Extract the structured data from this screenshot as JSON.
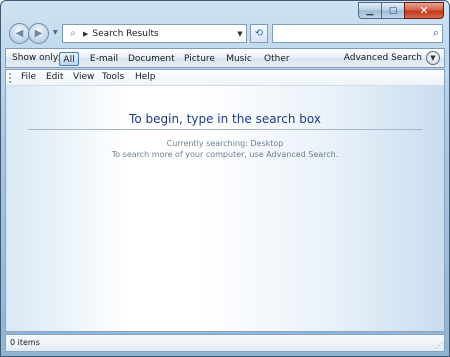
{
  "window": {
    "controls": {
      "minimize": "▁",
      "maximize": "▢",
      "close": "✕"
    }
  },
  "nav": {
    "address_text": "Search Results",
    "search_value": "",
    "icons": {
      "back": "back-arrow-icon",
      "forward": "forward-arrow-icon",
      "address": "search-magnifier-icon",
      "refresh": "refresh-icon",
      "search": "search-icon"
    }
  },
  "filter": {
    "label": "Show only:",
    "items": [
      "All",
      "E-mail",
      "Document",
      "Picture",
      "Music",
      "Other"
    ],
    "selected": "All",
    "advanced": "Advanced Search"
  },
  "menu": {
    "items": [
      "File",
      "Edit",
      "View",
      "Tools",
      "Help"
    ]
  },
  "content": {
    "title": "To begin, type in the search box",
    "line1": "Currently searching: Desktop",
    "line2": "To search more of your computer, use Advanced Search."
  },
  "status": {
    "text": "0 items"
  },
  "colors": {
    "accent_title": "#1e3a86",
    "close_button": "#c1452a",
    "frame": "#a9c8e2"
  }
}
